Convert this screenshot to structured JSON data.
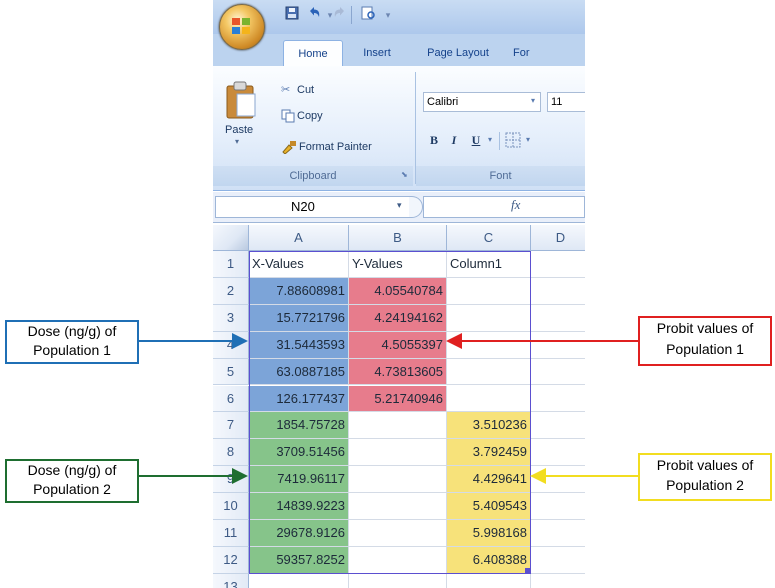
{
  "excel": {
    "tabs": [
      "Home",
      "Insert",
      "Page Layout",
      "For"
    ],
    "active_tab": "Home",
    "clipboard": {
      "paste_label": "Paste",
      "cut_label": "Cut",
      "copy_label": "Copy",
      "format_painter_label": "Format Painter",
      "group_label": "Clipboard"
    },
    "font": {
      "font_name": "Calibri",
      "font_size": "11",
      "bold_label": "B",
      "italic_label": "I",
      "underline_label": "U",
      "group_label": "Font"
    },
    "name_box_value": "N20",
    "fx_label": "fx",
    "column_headers": [
      "A",
      "B",
      "C",
      "D"
    ],
    "row_numbers": [
      "1",
      "2",
      "3",
      "4",
      "5",
      "6",
      "7",
      "8",
      "9",
      "10",
      "11",
      "12",
      "13"
    ],
    "rows": [
      [
        "X-Values",
        "Y-Values",
        "Column1",
        ""
      ],
      [
        "7.88608981",
        "4.05540784",
        "",
        ""
      ],
      [
        "15.7721796",
        "4.24194162",
        "",
        ""
      ],
      [
        "31.5443593",
        "4.5055397",
        "",
        ""
      ],
      [
        "63.0887185",
        "4.73813605",
        "",
        ""
      ],
      [
        "126.177437",
        "5.21740946",
        "",
        ""
      ],
      [
        "1854.75728",
        "",
        "3.510236",
        ""
      ],
      [
        "3709.51456",
        "",
        "3.792459",
        ""
      ],
      [
        "7419.96117",
        "",
        "4.429641",
        ""
      ],
      [
        "14839.9223",
        "",
        "5.409543",
        ""
      ],
      [
        "29678.9126",
        "",
        "5.998168",
        ""
      ],
      [
        "59357.8252",
        "",
        "6.408388",
        ""
      ],
      [
        "",
        "",
        "",
        ""
      ]
    ]
  },
  "annotations": {
    "dose_pop1": {
      "line1": "Dose (ng/g) of",
      "line2": "Population 1",
      "color": "#1f6fb5"
    },
    "dose_pop2": {
      "line1": "Dose (ng/g) of",
      "line2": "Population 2",
      "color": "#1e6e30"
    },
    "probit_pop1": {
      "line1": "Probit values of",
      "line2": "Population 1",
      "color": "#e02020"
    },
    "probit_pop2": {
      "line1": "Probit values of",
      "line2": "Population 2",
      "color": "#f2dd20"
    }
  },
  "colors": {
    "pop1_x_fill": "#7ca4d8",
    "pop1_y_fill": "#e77c8c",
    "pop2_x_fill": "#86c48a",
    "pop2_c_fill": "#f7e27a",
    "table_border": "#5b4fd0"
  }
}
